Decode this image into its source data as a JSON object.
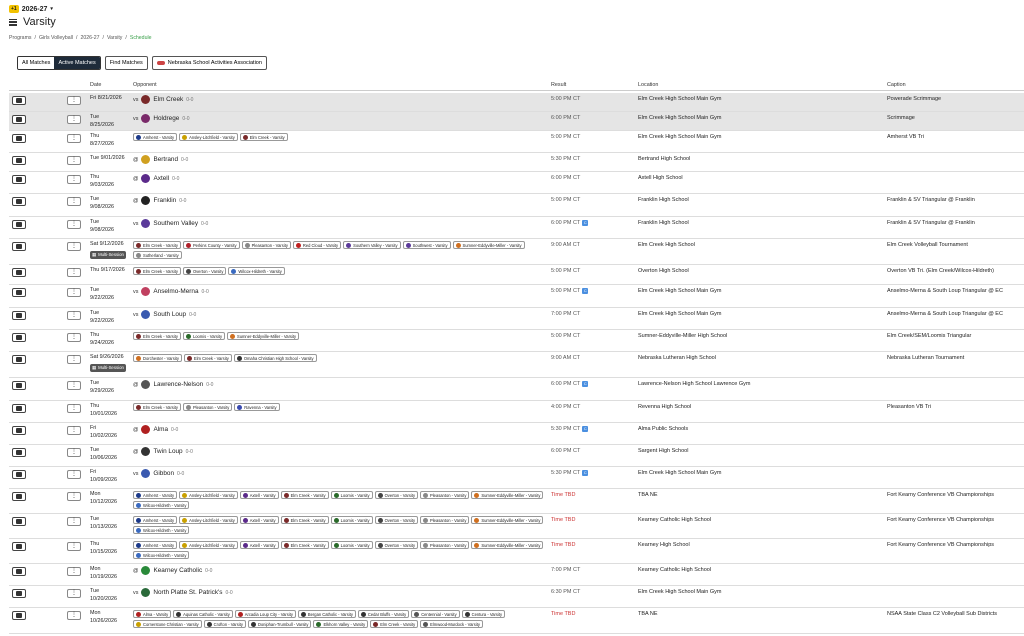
{
  "season": {
    "badge": "+1",
    "label": "2026-27"
  },
  "page_title": "Varsity",
  "breadcrumbs": [
    "Programs",
    "/",
    "Girls Volleyball",
    "/",
    "2026-27",
    "/",
    "Varsity",
    "/",
    "Schedule"
  ],
  "filters": {
    "all": "All Matches",
    "active": "Active Matches",
    "find": "Find Matches",
    "assoc": "Nebraska School Activities Association"
  },
  "columns": {
    "date": "Date",
    "opponent": "Opponent",
    "result": "Result",
    "location": "Location",
    "caption": "Caption"
  },
  "colors": {
    "selected_row": "#e5e5e5",
    "tbd": "#cc3333",
    "schedule_crumb": "#3aa04a",
    "active_filter": "#1e2b3a",
    "conference_badge": "#4a8fe0"
  },
  "multi_label": "Multi-Session",
  "rows": [
    {
      "date1": "Fri 8/21/2026",
      "date2": "",
      "vs": "vs",
      "team": "Elm Creek",
      "rec": "0-0",
      "color": "#7a2a2a",
      "result": "5:00 PM CT",
      "tbd": false,
      "conf": false,
      "loc": "Elm Creek High School Main Gym",
      "cap": "Powerade Scrimmage",
      "sel": true
    },
    {
      "date1": "Tue",
      "date2": "8/25/2026",
      "vs": "vs",
      "team": "Holdrege",
      "rec": "0-0",
      "color": "#7a2a6a",
      "result": "6:00 PM CT",
      "tbd": false,
      "conf": false,
      "loc": "Elm Creek High School Main Gym",
      "cap": "Scrimmage",
      "sel": true
    },
    {
      "date1": "Thu",
      "date2": "8/27/2026",
      "chips": [
        [
          "Amherst - Varsity",
          "#1c3a8a"
        ],
        [
          "Ansley-Litchfield - Varsity",
          "#c9a000"
        ],
        [
          "Elm Creek - Varsity",
          "#7a2a2a"
        ]
      ],
      "result": "5:00 PM CT",
      "tbd": false,
      "conf": false,
      "loc": "Elm Creek High School Main Gym",
      "cap": "Amherst VB Tri"
    },
    {
      "date1": "Tue 9/01/2026",
      "date2": "",
      "vs": "@",
      "team": "Bertrand",
      "rec": "0-0",
      "color": "#d0a020",
      "result": "5:30 PM CT",
      "tbd": false,
      "conf": false,
      "loc": "Bertrand High School",
      "cap": ""
    },
    {
      "date1": "Thu",
      "date2": "9/03/2026",
      "vs": "@",
      "team": "Axtell",
      "rec": "0-0",
      "color": "#5b2a8a",
      "result": "6:00 PM CT",
      "tbd": false,
      "conf": false,
      "loc": "Axtell High School",
      "cap": ""
    },
    {
      "date1": "Tue",
      "date2": "9/08/2026",
      "vs": "@",
      "team": "Franklin",
      "rec": "0-0",
      "color": "#222222",
      "result": "5:00 PM CT",
      "tbd": false,
      "conf": false,
      "loc": "Franklin High School",
      "cap": "Franklin & SV Triangular @ Franklin"
    },
    {
      "date1": "Tue",
      "date2": "9/08/2026",
      "vs": "vs",
      "team": "Southern Valley",
      "rec": "0-0",
      "color": "#5b3a9a",
      "result": "6:00 PM CT",
      "tbd": false,
      "conf": true,
      "loc": "Franklin High School",
      "cap": "Franklin & SV Triangular @ Franklin"
    },
    {
      "date1": "Sat 9/12/2026",
      "date2": "",
      "multi": true,
      "chips": [
        [
          "Elm Creek - Varsity",
          "#7a2a2a"
        ],
        [
          "Perkins County - Varsity",
          "#b0202a"
        ],
        [
          "Pleasanton - Varsity",
          "#888888"
        ],
        [
          "Red Cloud - Varsity",
          "#c02020"
        ],
        [
          "Southern Valley - Varsity",
          "#5b3a9a"
        ],
        [
          "Southwest - Varsity",
          "#5b3a9a"
        ],
        [
          "Sumner-Eddyville-Miller - Varsity",
          "#d07020"
        ],
        [
          "Sutherland - Varsity",
          "#888888"
        ]
      ],
      "result": "9:00 AM CT",
      "tbd": false,
      "conf": false,
      "loc": "Elm Creek High School",
      "cap": "Elm Creek Volleyball Tournament"
    },
    {
      "date1": "Thu 9/17/2026",
      "date2": "",
      "chips": [
        [
          "Elm Creek - Varsity",
          "#7a2a2a"
        ],
        [
          "Overton - Varsity",
          "#444444"
        ],
        [
          "Wilcox-Hildreth - Varsity",
          "#3a6ac0"
        ]
      ],
      "result": "5:00 PM CT",
      "tbd": false,
      "conf": false,
      "loc": "Overton High School",
      "cap": "Overton VB Tri. (Elm Creek/Wilcox-Hildreth)"
    },
    {
      "date1": "Tue",
      "date2": "9/22/2026",
      "vs": "vs",
      "team": "Anselmo-Merna",
      "rec": "0-0",
      "color": "#c04060",
      "result": "5:00 PM CT",
      "tbd": false,
      "conf": true,
      "loc": "Elm Creek High School Main Gym",
      "cap": "Anselmo-Merna & South Loup Triangular @ EC"
    },
    {
      "date1": "Tue",
      "date2": "9/22/2026",
      "vs": "vs",
      "team": "South Loup",
      "rec": "0-0",
      "color": "#3a5ab0",
      "result": "7:00 PM CT",
      "tbd": false,
      "conf": false,
      "loc": "Elm Creek High School Main Gym",
      "cap": "Anselmo-Merna & South Loup Triangular @ EC"
    },
    {
      "date1": "Thu",
      "date2": "9/24/2026",
      "chips": [
        [
          "Elm Creek - Varsity",
          "#7a2a2a"
        ],
        [
          "Loomis - Varsity",
          "#2a6a2a"
        ],
        [
          "Sumner-Eddyville-Miller - Varsity",
          "#d07020"
        ]
      ],
      "result": "5:00 PM CT",
      "tbd": false,
      "conf": false,
      "loc": "Sumner-Eddyville-Miller High School",
      "cap": "Elm Creek/SEM/Loomis Triangular"
    },
    {
      "date1": "Sat 9/26/2026",
      "date2": "",
      "multi": true,
      "chips": [
        [
          "Dorchester - Varsity",
          "#d07020"
        ],
        [
          "Elm Creek - Varsity",
          "#7a2a2a"
        ],
        [
          "Omaha Christian High School - Varsity",
          "#333333"
        ]
      ],
      "result": "9:00 AM CT",
      "tbd": false,
      "conf": false,
      "loc": "Nebraska Lutheran High School",
      "cap": "Nebraska Lutheran Tournament"
    },
    {
      "date1": "Tue",
      "date2": "9/29/2026",
      "vs": "@",
      "team": "Lawrence-Nelson",
      "rec": "0-0",
      "color": "#555555",
      "result": "6:00 PM CT",
      "tbd": false,
      "conf": true,
      "loc": "Lawrence-Nelson High School Lawrence Gym",
      "cap": ""
    },
    {
      "date1": "Thu",
      "date2": "10/01/2026",
      "chips": [
        [
          "Elm Creek - Varsity",
          "#7a2a2a"
        ],
        [
          "Pleasanton - Varsity",
          "#888888"
        ],
        [
          "Ravenna - Varsity",
          "#3a4ab0"
        ]
      ],
      "result": "4:00 PM CT",
      "tbd": false,
      "conf": false,
      "loc": "Revenna High School",
      "cap": "Pleasanton VB Tri"
    },
    {
      "date1": "Fri",
      "date2": "10/02/2026",
      "vs": "@",
      "team": "Alma",
      "rec": "0-0",
      "color": "#b02020",
      "result": "5:30 PM CT",
      "tbd": false,
      "conf": true,
      "loc": "Alma Public Schools",
      "cap": ""
    },
    {
      "date1": "Tue",
      "date2": "10/06/2026",
      "vs": "@",
      "team": "Twin Loup",
      "rec": "0-0",
      "color": "#333333",
      "result": "6:00 PM CT",
      "tbd": false,
      "conf": false,
      "loc": "Sargent High School",
      "cap": ""
    },
    {
      "date1": "Fri",
      "date2": "10/09/2026",
      "vs": "vs",
      "team": "Gibbon",
      "rec": "0-0",
      "color": "#3a5ab0",
      "result": "5:30 PM CT",
      "tbd": false,
      "conf": true,
      "loc": "Elm Creek High School Main Gym",
      "cap": ""
    },
    {
      "date1": "Mon",
      "date2": "10/12/2026",
      "chips": [
        [
          "Amherst - Varsity",
          "#1c3a8a"
        ],
        [
          "Ansley-Litchfield - Varsity",
          "#c9a000"
        ],
        [
          "Axtell - Varsity",
          "#5b2a8a"
        ],
        [
          "Elm Creek - Varsity",
          "#7a2a2a"
        ],
        [
          "Loomis - Varsity",
          "#2a6a2a"
        ],
        [
          "Overton - Varsity",
          "#444444"
        ],
        [
          "Pleasanton - Varsity",
          "#888888"
        ],
        [
          "Sumner-Eddyville-Miller - Varsity",
          "#d07020"
        ],
        [
          "Wilcox-Hildreth - Varsity",
          "#3a6ac0"
        ]
      ],
      "result": "Time TBD",
      "tbd": true,
      "conf": false,
      "loc": "TBA NE",
      "cap": "Fort Kearny Conference VB Championships"
    },
    {
      "date1": "Tue",
      "date2": "10/13/2026",
      "chips": [
        [
          "Amherst - Varsity",
          "#1c3a8a"
        ],
        [
          "Ansley-Litchfield - Varsity",
          "#c9a000"
        ],
        [
          "Axtell - Varsity",
          "#5b2a8a"
        ],
        [
          "Elm Creek - Varsity",
          "#7a2a2a"
        ],
        [
          "Loomis - Varsity",
          "#2a6a2a"
        ],
        [
          "Overton - Varsity",
          "#444444"
        ],
        [
          "Pleasanton - Varsity",
          "#888888"
        ],
        [
          "Sumner-Eddyville-Miller - Varsity",
          "#d07020"
        ],
        [
          "Wilcox-Hildreth - Varsity",
          "#3a6ac0"
        ]
      ],
      "result": "Time TBD",
      "tbd": true,
      "conf": false,
      "loc": "Kearney Catholic High School",
      "cap": "Fort Kearny Conference VB Championships"
    },
    {
      "date1": "Thu",
      "date2": "10/15/2026",
      "chips": [
        [
          "Amherst - Varsity",
          "#1c3a8a"
        ],
        [
          "Ansley-Litchfield - Varsity",
          "#c9a000"
        ],
        [
          "Axtell - Varsity",
          "#5b2a8a"
        ],
        [
          "Elm Creek - Varsity",
          "#7a2a2a"
        ],
        [
          "Loomis - Varsity",
          "#2a6a2a"
        ],
        [
          "Overton - Varsity",
          "#444444"
        ],
        [
          "Pleasanton - Varsity",
          "#888888"
        ],
        [
          "Sumner-Eddyville-Miller - Varsity",
          "#d07020"
        ],
        [
          "Wilcox-Hildreth - Varsity",
          "#3a6ac0"
        ]
      ],
      "result": "Time TBD",
      "tbd": true,
      "conf": false,
      "loc": "Kearney High School",
      "cap": "Fort Kearny Conference VB Championships"
    },
    {
      "date1": "Mon",
      "date2": "10/19/2026",
      "vs": "@",
      "team": "Kearney Catholic",
      "rec": "0-0",
      "color": "#2a8a3a",
      "result": "7:00 PM CT",
      "tbd": false,
      "conf": false,
      "loc": "Kearney Catholic High School",
      "cap": ""
    },
    {
      "date1": "Tue",
      "date2": "10/20/2026",
      "vs": "vs",
      "team": "North Platte St. Patrick's",
      "rec": "0-0",
      "color": "#2a6a3a",
      "result": "6:30 PM CT",
      "tbd": false,
      "conf": false,
      "loc": "Elm Creek High School Main Gym",
      "cap": ""
    },
    {
      "date1": "Mon",
      "date2": "10/26/2026",
      "chips": [
        [
          "Alma - Varsity",
          "#b02020"
        ],
        [
          "Aquinas Catholic - Varsity",
          "#333333"
        ],
        [
          "Arcadia Loup City - Varsity",
          "#b02020"
        ],
        [
          "Bergan Catholic - Varsity",
          "#333333"
        ],
        [
          "Cedar Bluffs - Varsity",
          "#333333"
        ],
        [
          "Centennial - Varsity",
          "#555555"
        ],
        [
          "Centura - Varsity",
          "#333333"
        ],
        [
          "Cornerstone Christian - Varsity",
          "#c9a000"
        ],
        [
          "Crofton - Varsity",
          "#333333"
        ],
        [
          "Doniphan-Trumbull - Varsity",
          "#333333"
        ],
        [
          "Elkhorn Valley - Varsity",
          "#2a6a2a"
        ],
        [
          "Elm Creek - Varsity",
          "#7a2a2a"
        ],
        [
          "Elmwood-Murdock - Varsity",
          "#555555"
        ]
      ],
      "result": "Time TBD",
      "tbd": true,
      "conf": false,
      "loc": "TBA NE",
      "cap": "NSAA State Class C2 Volleyball Sub Districts"
    }
  ]
}
